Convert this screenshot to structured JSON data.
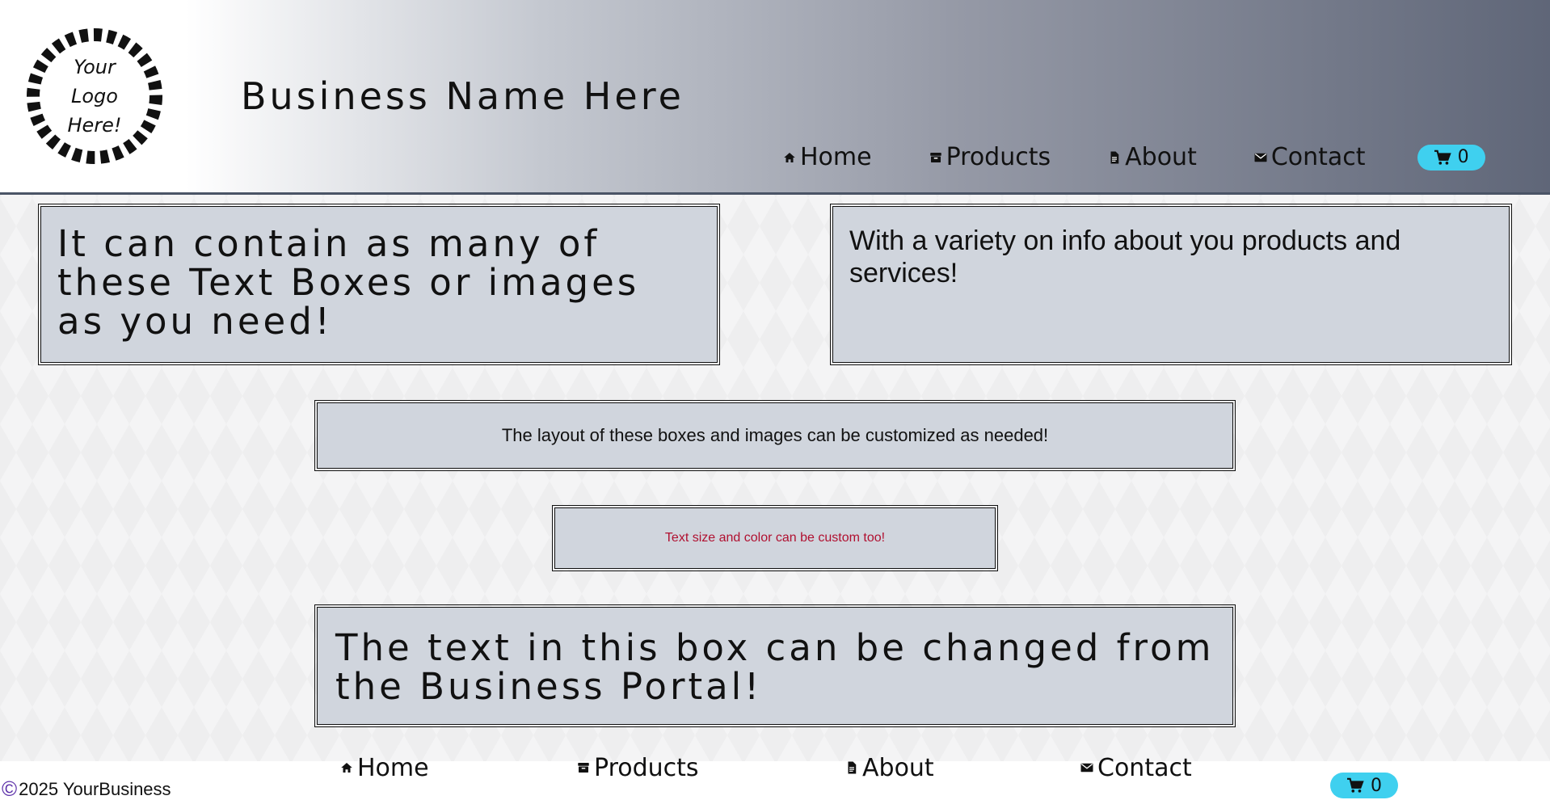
{
  "header": {
    "logo_lines": [
      "Your",
      "Logo",
      "Here!"
    ],
    "business_name": "Business Name Here",
    "nav": [
      {
        "label": "Home",
        "icon": "home-icon"
      },
      {
        "label": "Products",
        "icon": "archive-icon"
      },
      {
        "label": "About",
        "icon": "document-icon"
      },
      {
        "label": "Contact",
        "icon": "mail-icon"
      }
    ],
    "cart": {
      "icon": "cart-icon",
      "count": "0",
      "color": "#3fd0ef"
    }
  },
  "boxes": [
    {
      "text": "It can contain as many of these Text Boxes or images as you need!"
    },
    {
      "text": "With a variety on info about you products and services!"
    },
    {
      "text": "The layout of these boxes and images can be customized as needed!"
    },
    {
      "text": "Text size and color can be custom too!",
      "color": "#b01030"
    },
    {
      "text": "The text in this box can be changed from the Business Portal!"
    }
  ],
  "footer": {
    "copyright_icon": "copyright-icon",
    "copyright_text": "2025 YourBusiness",
    "nav": [
      {
        "label": "Home",
        "icon": "home-icon"
      },
      {
        "label": "Products",
        "icon": "archive-icon"
      },
      {
        "label": "About",
        "icon": "document-icon"
      },
      {
        "label": "Contact",
        "icon": "mail-icon"
      }
    ],
    "cart": {
      "icon": "cart-icon",
      "count": "0"
    }
  }
}
